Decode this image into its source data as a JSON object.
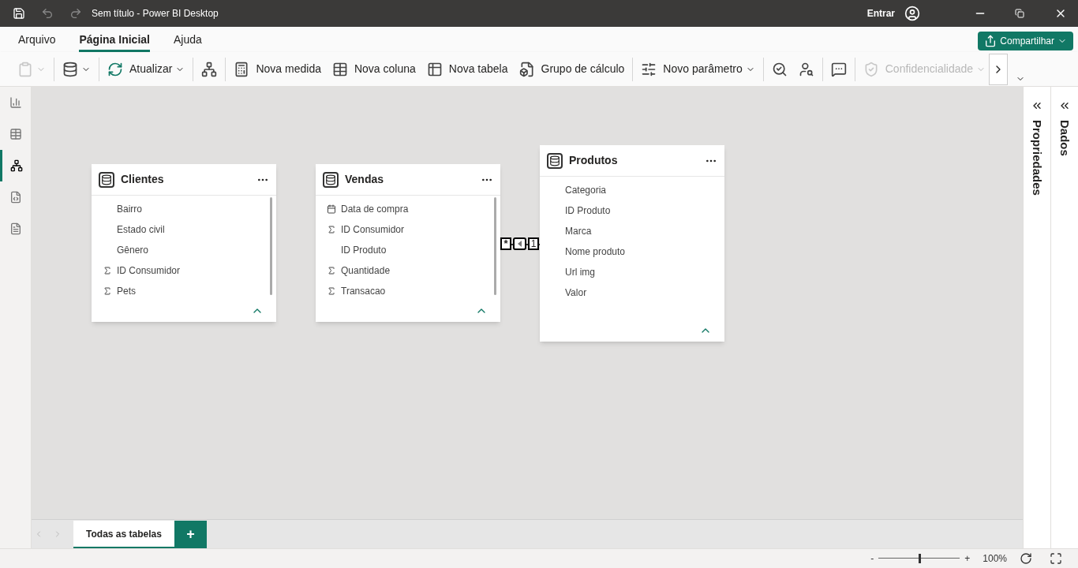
{
  "window": {
    "title": "Sem título - Power BI Desktop",
    "sign_in": "Entrar"
  },
  "menu_tabs": [
    {
      "label": "Arquivo",
      "selected": false
    },
    {
      "label": "Página Inicial",
      "selected": true
    },
    {
      "label": "Ajuda",
      "selected": false
    }
  ],
  "share_button": "Compartilhar",
  "ribbon": [
    [
      {
        "dropdown": true,
        "disabled": true
      }
    ],
    [
      {
        "dropdown": true,
        "disabled": false
      }
    ],
    [
      {
        "label": "Atualizar",
        "dropdown": true,
        "disabled": false
      }
    ],
    [
      {
        "dropdown": false,
        "disabled": false
      }
    ],
    [
      {
        "label": "Nova medida",
        "dropdown": false,
        "disabled": false
      },
      {
        "label": "Nova coluna",
        "dropdown": false,
        "disabled": false
      },
      {
        "label": "Nova tabela",
        "dropdown": false,
        "disabled": false
      },
      {
        "label": "Grupo de cálculo",
        "dropdown": false,
        "disabled": false
      }
    ],
    [
      {
        "label": "Novo parâmetro",
        "dropdown": true,
        "disabled": false
      }
    ],
    [
      {
        "dropdown": false,
        "disabled": false
      },
      {
        "dropdown": false,
        "disabled": false
      }
    ],
    [
      {
        "dropdown": false,
        "disabled": false
      }
    ],
    [
      {
        "label": "Confidencialidade",
        "dropdown": true,
        "disabled": true
      }
    ]
  ],
  "left_rail": [
    {
      "selected": false
    },
    {
      "selected": false
    },
    {
      "selected": true
    },
    {
      "selected": false
    },
    {
      "selected": false
    }
  ],
  "tables": [
    {
      "name": "Clientes",
      "scrollbar": true,
      "fields": [
        {
          "name": "Bairro",
          "kind": "text"
        },
        {
          "name": "Estado civil",
          "kind": "text"
        },
        {
          "name": "Gênero",
          "kind": "text"
        },
        {
          "name": "ID Consumidor",
          "kind": "sum"
        },
        {
          "name": "Pets",
          "kind": "sum"
        }
      ]
    },
    {
      "name": "Vendas",
      "scrollbar": true,
      "fields": [
        {
          "name": "Data de compra",
          "kind": "date"
        },
        {
          "name": "ID Consumidor",
          "kind": "sum"
        },
        {
          "name": "ID Produto",
          "kind": "text"
        },
        {
          "name": "Quantidade",
          "kind": "sum"
        },
        {
          "name": "Transacao",
          "kind": "sum"
        }
      ]
    },
    {
      "name": "Produtos",
      "scrollbar": false,
      "fields": [
        {
          "name": "Categoria",
          "kind": "text"
        },
        {
          "name": "ID Produto",
          "kind": "text"
        },
        {
          "name": "Marca",
          "kind": "text"
        },
        {
          "name": "Nome produto",
          "kind": "text"
        },
        {
          "name": "Url img",
          "kind": "text"
        },
        {
          "name": "Valor",
          "kind": "text"
        }
      ]
    }
  ],
  "relationship": {
    "from_cardinality": "*",
    "to_cardinality": "1"
  },
  "side_panes": [
    "Propriedades",
    "Dados"
  ],
  "layout_tabs": [
    {
      "label": "Todas as tabelas",
      "selected": true
    }
  ],
  "add_tab": "+",
  "zoom": {
    "minus": "-",
    "plus": "+",
    "level": 0.5,
    "reading": "100%"
  }
}
